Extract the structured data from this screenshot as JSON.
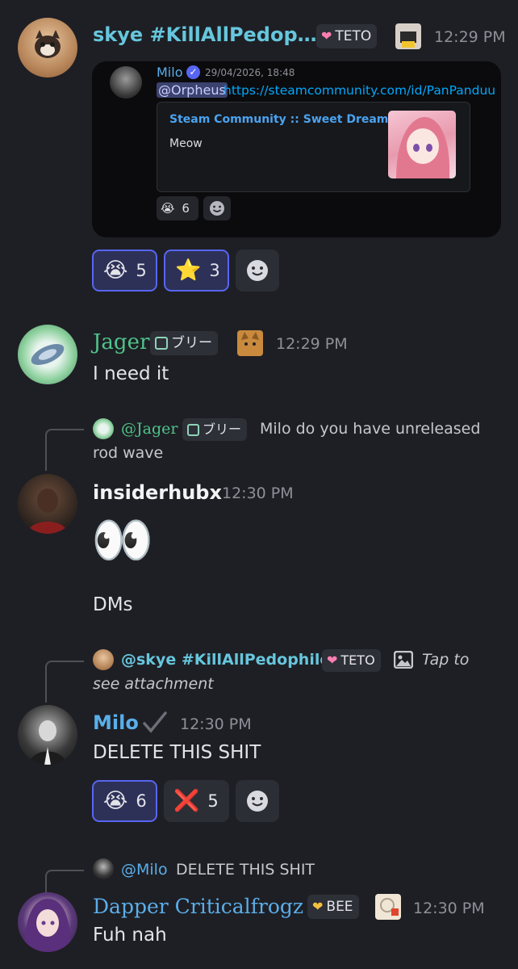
{
  "messages": [
    {
      "author": "skye #KillAllPedop…",
      "role_tag": "TETO",
      "time": "12:29 PM",
      "forward": {
        "author": "Milo",
        "date": "29/04/2026, 18:48",
        "mention": "@Orpheus",
        "link": "https://steamcommunity.com/id/PanPanduu",
        "embed_title": "Steam Community :: Sweet Dreams",
        "embed_desc": "Meow",
        "reaction_count": "6"
      },
      "reactions": [
        {
          "emoji": "😭",
          "count": "5"
        },
        {
          "emoji": "⭐",
          "count": "3"
        }
      ]
    },
    {
      "author": "Jager",
      "role_tag": "ブリー",
      "time": "12:29 PM",
      "text": "I need it"
    },
    {
      "reply": {
        "mention": "@Jager",
        "role_tag": "ブリー",
        "text_line1": "Milo do you have unreleased",
        "text_line2": "rod wave"
      },
      "author": "insiderhubx",
      "time": "12:30 PM",
      "emoji": "👀",
      "text": "DMs"
    },
    {
      "reply": {
        "mention": "@skye #KillAllPedophiles",
        "role_tag": "TETO",
        "text_line1": "Tap to",
        "text_line2": "see attachment"
      },
      "author": "Milo",
      "time": "12:30 PM",
      "text": "DELETE THIS SHIT",
      "reactions": [
        {
          "emoji": "😭",
          "count": "6"
        },
        {
          "emoji": "❌",
          "count": "5"
        }
      ]
    },
    {
      "reply": {
        "mention": "@Milo",
        "text": "DELETE THIS SHIT"
      },
      "author": "Dapper Criticalfrogz",
      "role_tag": "BEE",
      "time": "12:30 PM",
      "text": "Fuh nah"
    }
  ],
  "colors": {
    "background": "#1e1f24",
    "author_blue": "#5aaeea",
    "author_cyan": "#66c6dd",
    "author_green": "#4fc38a",
    "link": "#00a8fc",
    "reaction_active_border": "#5865f2"
  }
}
